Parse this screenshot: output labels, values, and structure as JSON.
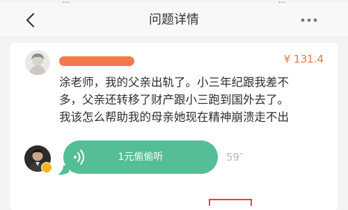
{
  "status_bar": {
    "left_text": "...",
    "right_text": "..."
  },
  "nav": {
    "title": "问题详情",
    "back_icon": "chevron-left-icon",
    "more_icon": "more-dots-icon"
  },
  "question": {
    "price": "¥ 131.4",
    "lines": [
      "涂老师，我的父亲出轨了。小三年纪跟我差不",
      "多，父亲还转移了财产跟小三跑到国外去了。",
      "我该怎么帮助我的母亲她现在精神崩溃走不出"
    ]
  },
  "answer": {
    "voice_label": "1元偷偷听",
    "duration": "59″",
    "wave_icon": "voice-wave-icon"
  },
  "colors": {
    "accent_orange": "#f3763e",
    "voice_green": "#55be96",
    "highlight_red": "#e9402f",
    "badge_gold": "#f2b51b"
  }
}
